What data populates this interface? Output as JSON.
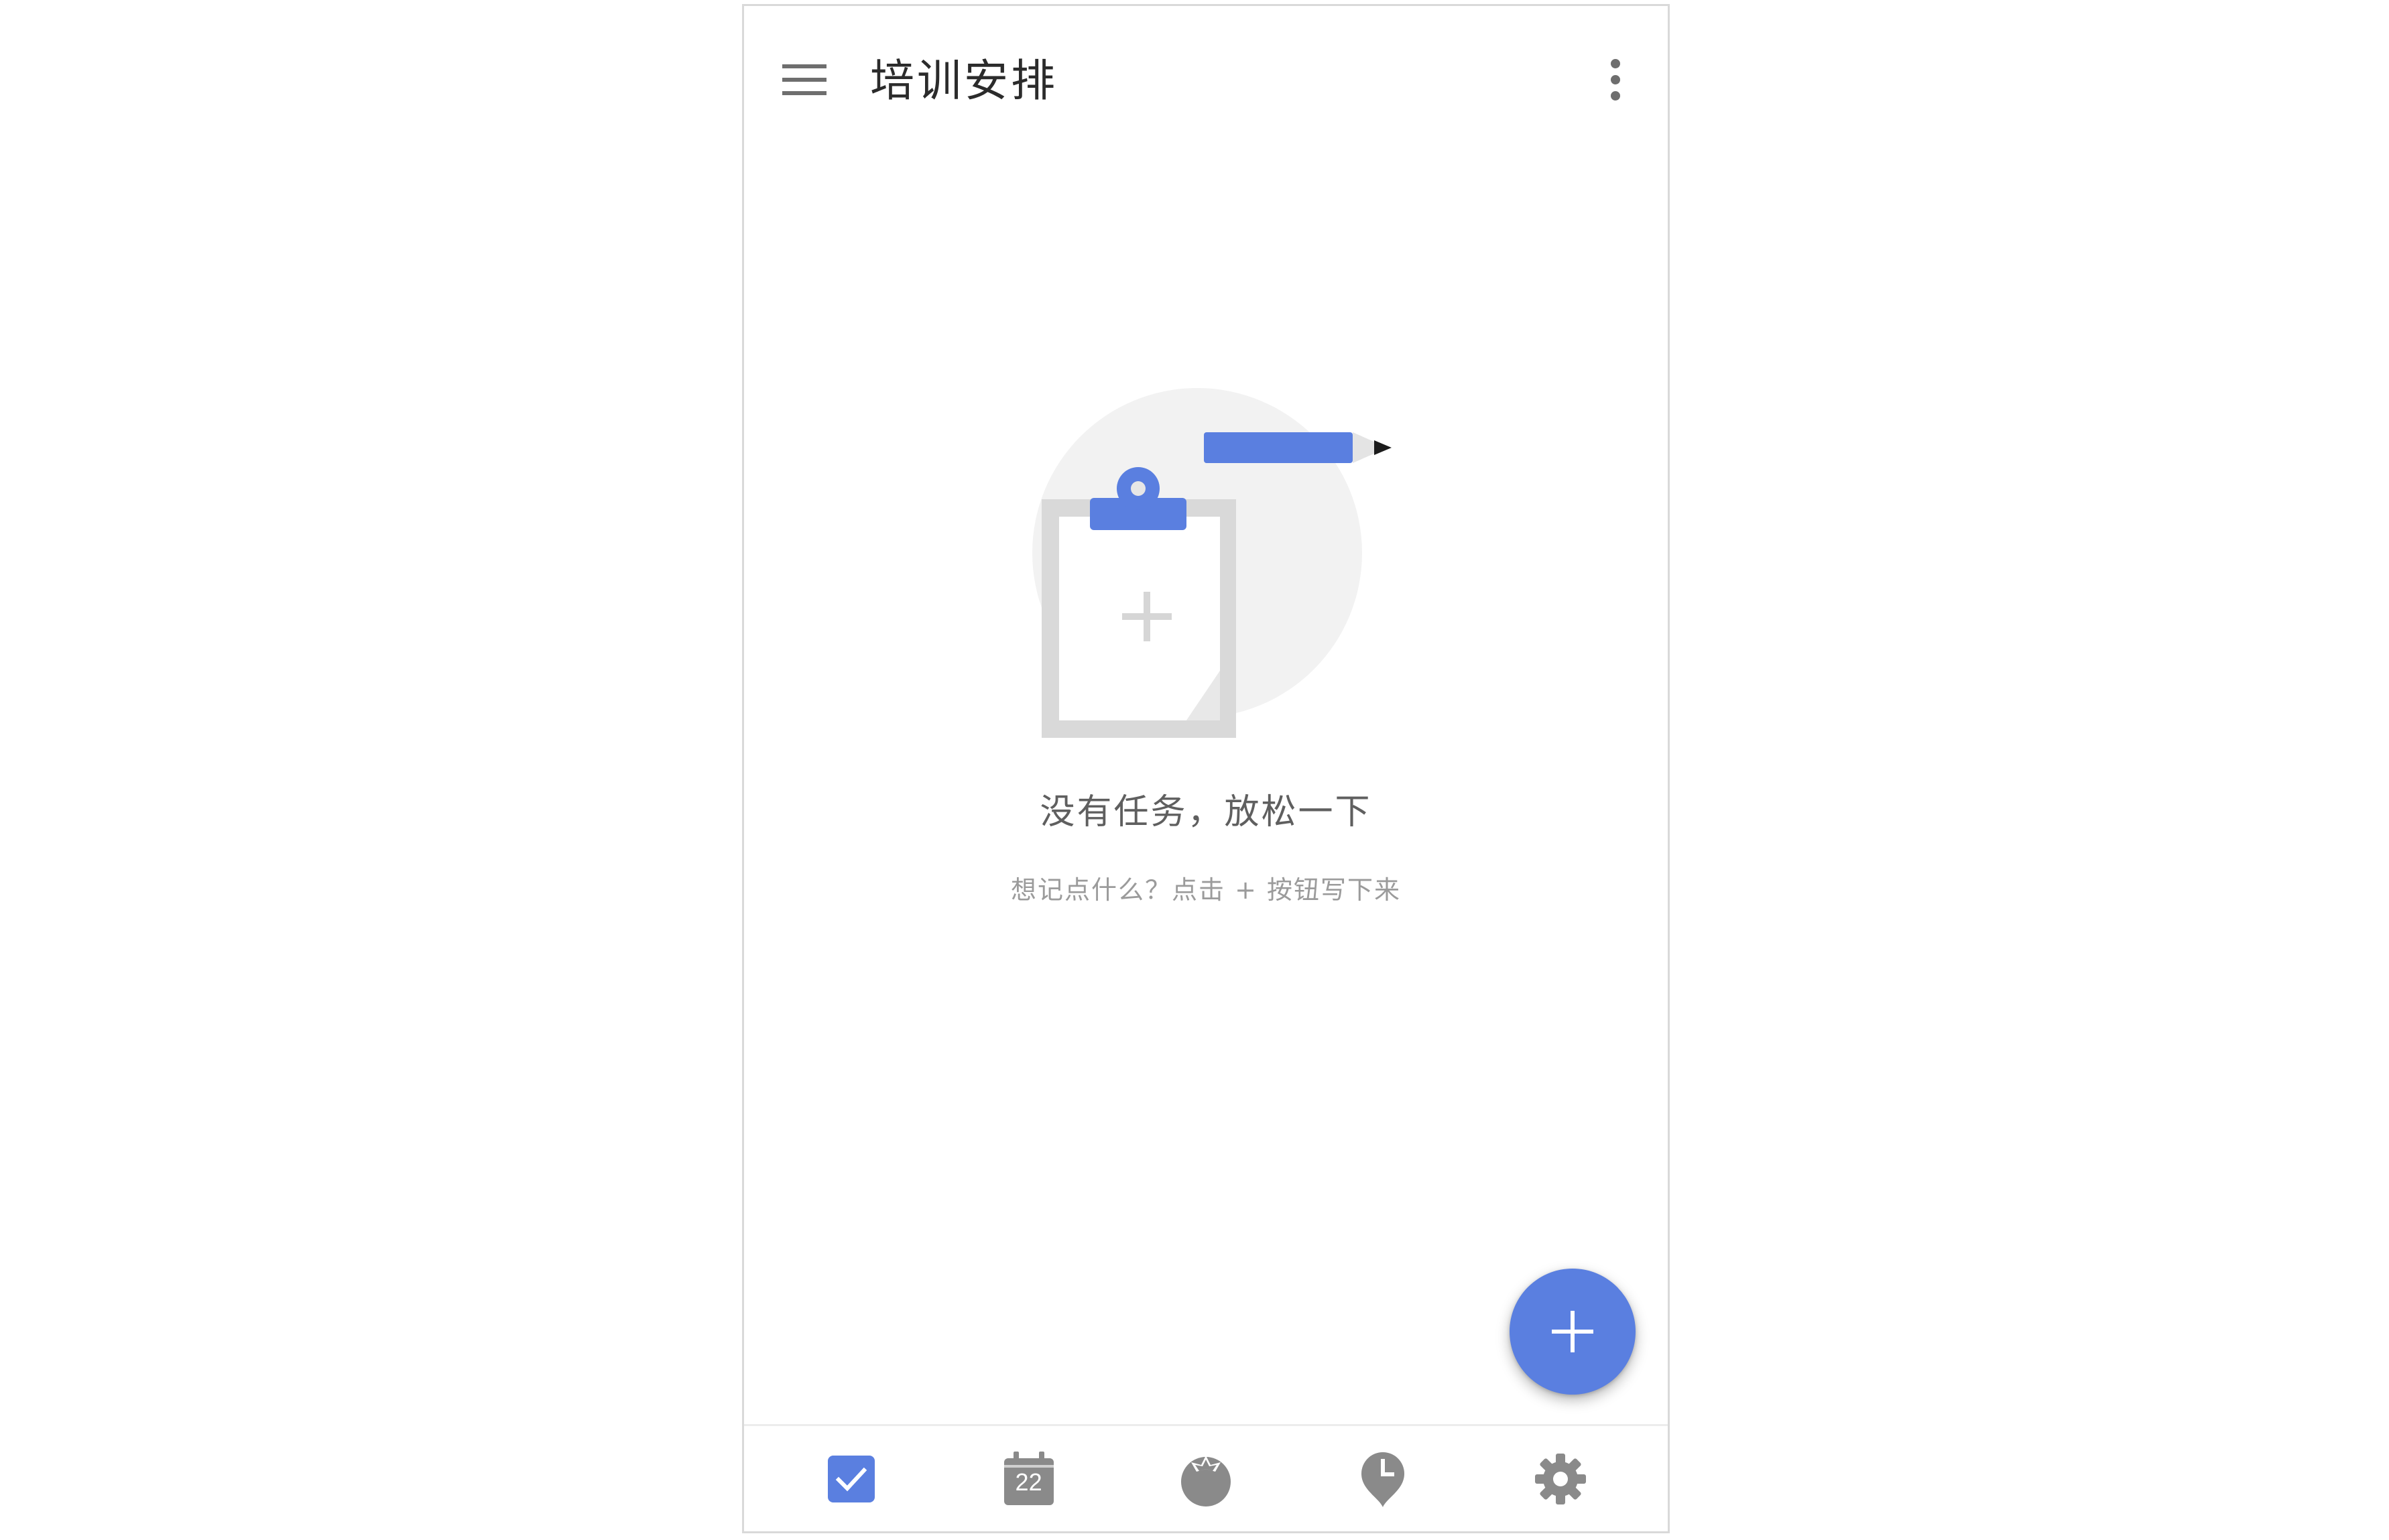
{
  "app_bar": {
    "title": "培训安排",
    "menu_icon": "hamburger-menu-icon",
    "more_icon": "more-vertical-icon"
  },
  "empty_state": {
    "illustration": "clipboard-pencil-illustration",
    "title": "没有任务，放松一下",
    "subtitle": "想记点什么？点击 + 按钮写下来"
  },
  "fab": {
    "icon": "plus-icon",
    "color": "#5a7fe0"
  },
  "bottom_nav": {
    "items": [
      {
        "name": "tasks",
        "icon": "checkbox-icon",
        "active": true
      },
      {
        "name": "calendar",
        "icon": "calendar-icon",
        "day": "22",
        "active": false
      },
      {
        "name": "habits",
        "icon": "tomato-icon",
        "active": false
      },
      {
        "name": "reminders",
        "icon": "clock-pin-icon",
        "active": false
      },
      {
        "name": "settings",
        "icon": "gear-icon",
        "active": false
      }
    ]
  },
  "colors": {
    "accent": "#5a7fe0",
    "icon_inactive": "#8a8a8a",
    "illustration_gray": "#dcdcdc"
  }
}
